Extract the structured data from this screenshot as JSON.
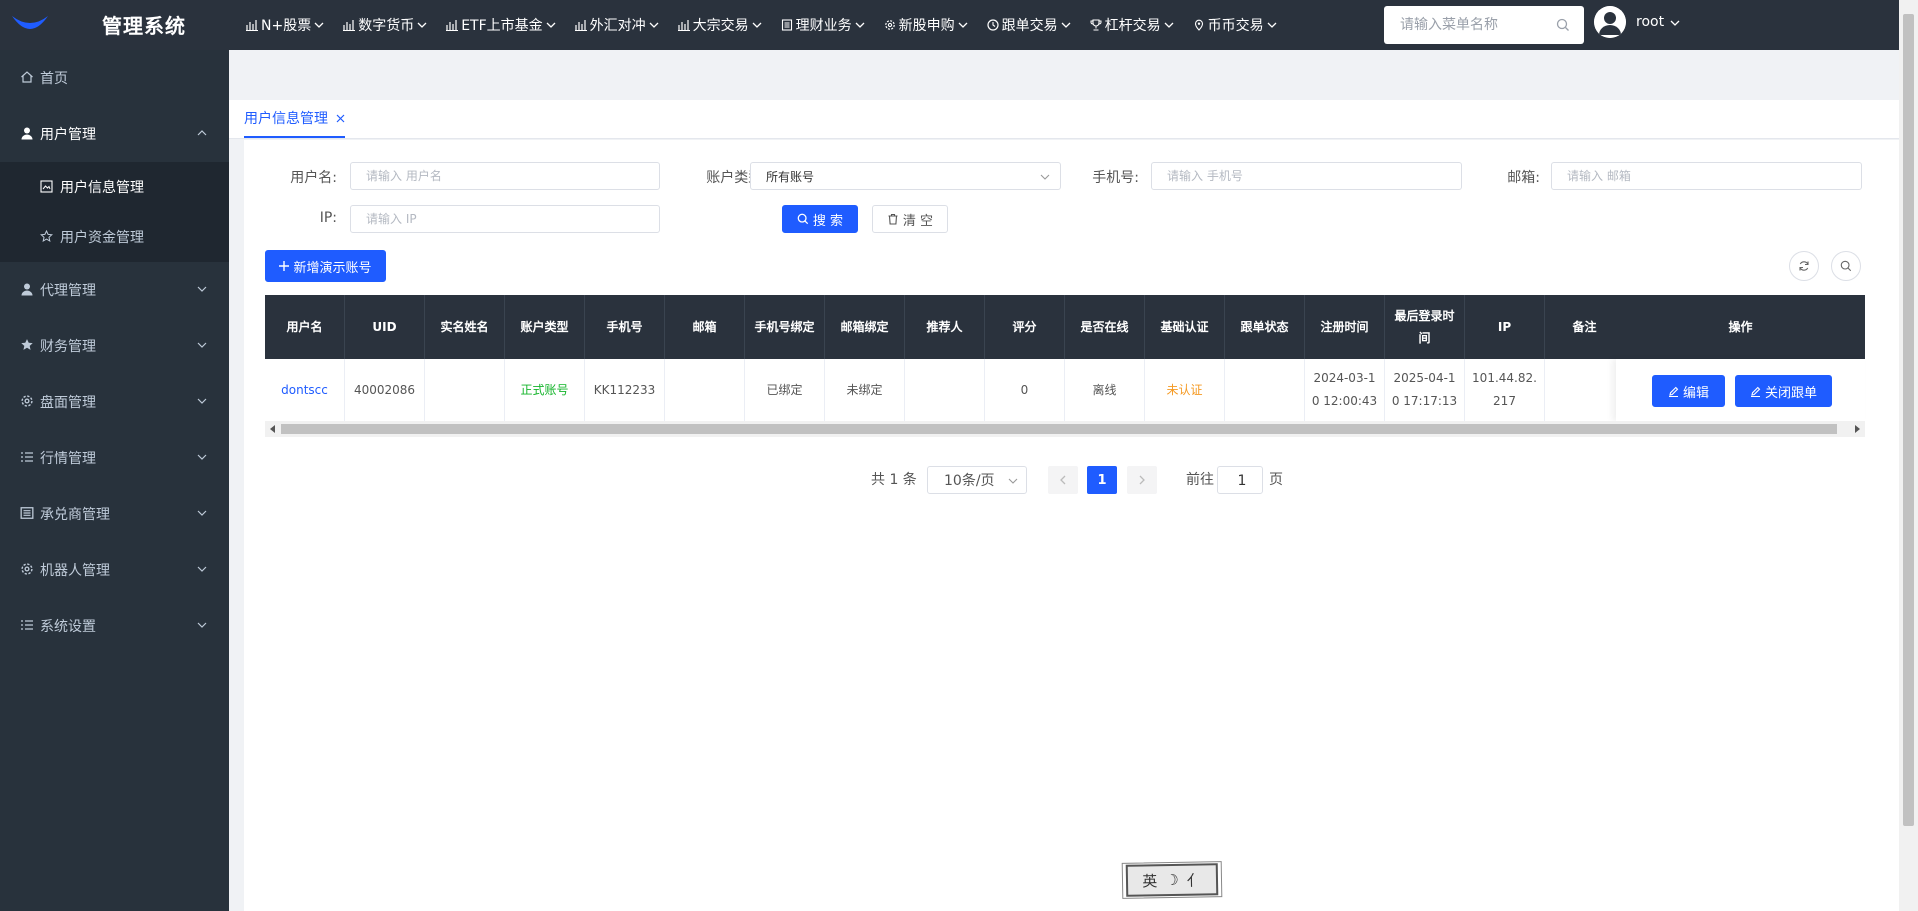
{
  "app": {
    "title": "管理系统"
  },
  "topnav": [
    {
      "label": "N+股票",
      "icon": "bar-chart-icon"
    },
    {
      "label": "数字货币",
      "icon": "bar-chart-icon"
    },
    {
      "label": "ETF上市基金",
      "icon": "bar-chart-icon"
    },
    {
      "label": "外汇对冲",
      "icon": "bar-chart-icon"
    },
    {
      "label": "大宗交易",
      "icon": "bar-chart-icon"
    },
    {
      "label": "理财业务",
      "icon": "document-icon"
    },
    {
      "label": "新股申购",
      "icon": "gear-icon"
    },
    {
      "label": "跟单交易",
      "icon": "clock-icon"
    },
    {
      "label": "杠杆交易",
      "icon": "trophy-icon"
    },
    {
      "label": "币币交易",
      "icon": "location-icon"
    }
  ],
  "menu_search": {
    "placeholder": "请输入菜单名称"
  },
  "user": {
    "name": "root"
  },
  "sidebar": {
    "home": "首页",
    "user_mgmt": "用户管理",
    "user_info": "用户信息管理",
    "user_funds": "用户资金管理",
    "agent": "代理管理",
    "finance": "财务管理",
    "disk": "盘面管理",
    "market": "行情管理",
    "acceptor": "承兑商管理",
    "robot": "机器人管理",
    "settings": "系统设置"
  },
  "tabs": [
    {
      "label": "用户信息管理"
    }
  ],
  "filters": {
    "username_label": "用户名:",
    "username_placeholder": "请输入 用户名",
    "account_type_label": "账户类型:",
    "account_type_value": "所有账号",
    "phone_label": "手机号:",
    "phone_placeholder": "请输入 手机号",
    "email_label": "邮箱:",
    "email_placeholder": "请输入 邮箱",
    "ip_label": "IP:",
    "ip_placeholder": "请输入 IP",
    "search_btn": "搜 索",
    "clear_btn": "清 空"
  },
  "actions": {
    "add_demo": "新增演示账号"
  },
  "table": {
    "columns": [
      "用户名",
      "UID",
      "实名姓名",
      "账户类型",
      "手机号",
      "邮箱",
      "手机号绑定",
      "邮箱绑定",
      "推荐人",
      "评分",
      "是否在线",
      "基础认证",
      "跟单状态",
      "注册时间",
      "最后登录时间",
      "IP",
      "备注",
      "操作"
    ],
    "rows": [
      {
        "username": "dontscc",
        "uid": "40002086",
        "real_name": "",
        "account_type": "正式账号",
        "phone": "KK112233",
        "email": "",
        "phone_bind": "已绑定",
        "email_bind": "未绑定",
        "referrer": "",
        "score": "0",
        "online": "离线",
        "basic_auth": "未认证",
        "follow_status": "",
        "register_time": "2024-03-10 12:00:43",
        "last_login": "2025-04-10 17:17:13",
        "ip": "101.44.82.217",
        "remark": "",
        "edit_btn": "编辑",
        "close_follow_btn": "关闭跟单"
      }
    ]
  },
  "pagination": {
    "total": "共 1 条",
    "page_size": "10条/页",
    "current": "1",
    "goto_label": "前往",
    "goto_value": "1",
    "page_suffix": "页"
  },
  "colors": {
    "primary": "#1f5cff",
    "topbar": "#2a323d",
    "sidebar": "#28323c",
    "green": "#13b42a",
    "orange": "#f59a23"
  }
}
